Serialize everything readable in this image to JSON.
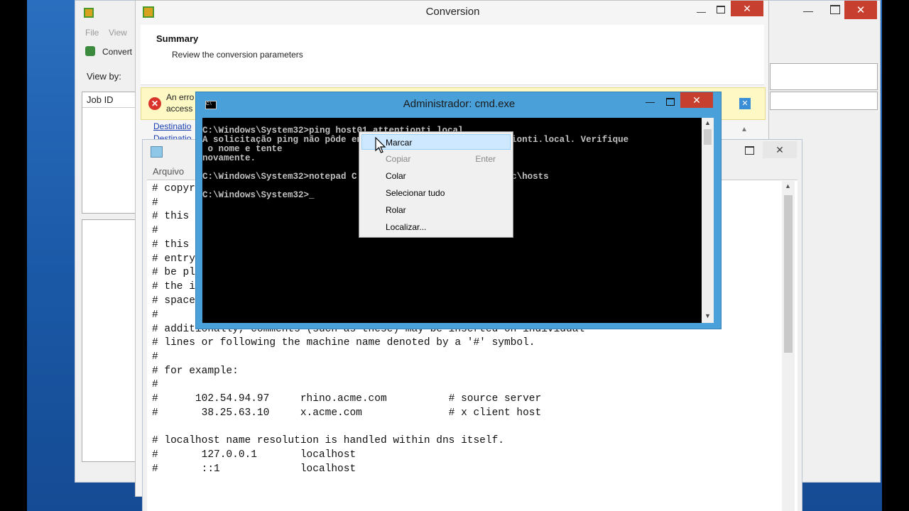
{
  "back_window": {
    "menu": {
      "file": "File",
      "view": "View"
    },
    "toolbar_convert": "Convert",
    "view_by_label": "View by:",
    "column_job_id": "Job ID"
  },
  "conversion": {
    "title": "Conversion",
    "summary_heading": "Summary",
    "summary_sub": "Review the conversion parameters",
    "error_line1": "An erro",
    "error_line2": "access",
    "link1": "Destinatio",
    "link2": "Destinatio"
  },
  "notepad": {
    "menu_file": "Arquivo",
    "lines": [
      "# copyr",
      "#",
      "# this",
      "#",
      "# this",
      "# entry",
      "# be pl",
      "# the i",
      "# space",
      "#",
      "# additionally, comments (such as these) may be inserted on individual",
      "# lines or following the machine name denoted by a '#' symbol.",
      "#",
      "# for example:",
      "#",
      "#      102.54.94.97     rhino.acme.com          # source server",
      "#       38.25.63.10     x.acme.com              # x client host",
      "",
      "# localhost name resolution is handled within dns itself.",
      "#       127.0.0.1       localhost",
      "#       ::1             localhost"
    ]
  },
  "cmd": {
    "title": "Administrador: cmd.exe",
    "lines": [
      "C:\\Windows\\System32>ping host01.attentionti.local",
      "A solicitação ping não pôde encontrar o host host01.attentionti.local. Verifique",
      " o nome e tente",
      "novamente.",
      "",
      "C:\\Windows\\System32>notepad C:\\Windows\\System32\\drivers\\etc\\hosts",
      "",
      "C:\\Windows\\System32>_"
    ]
  },
  "context_menu": {
    "items": [
      {
        "label": "Marcar",
        "shortcut": "",
        "state": "hover"
      },
      {
        "label": "Copiar",
        "shortcut": "Enter",
        "state": "disabled"
      },
      {
        "label": "Colar",
        "shortcut": "",
        "state": "normal"
      },
      {
        "label": "Selecionar tudo",
        "shortcut": "",
        "state": "normal"
      },
      {
        "label": "Rolar",
        "shortcut": "",
        "state": "normal"
      },
      {
        "label": "Localizar...",
        "shortcut": "",
        "state": "normal"
      }
    ]
  },
  "colors": {
    "desktop": "#1a5fb0",
    "cmd_frame": "#4aa0d8",
    "cmd_bg": "#000000",
    "close_red": "#c7402f",
    "menu_hover": "#cde8ff"
  }
}
